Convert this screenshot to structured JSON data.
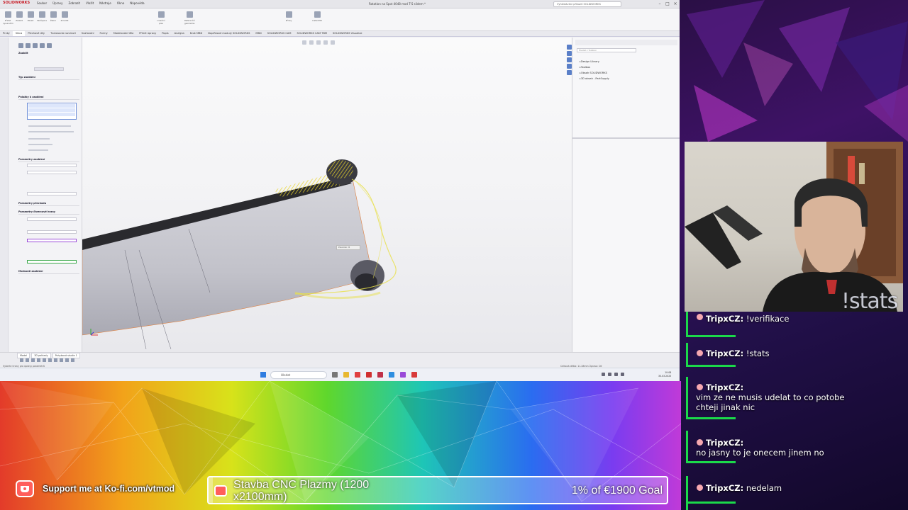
{
  "solidworks": {
    "app_name": "SOLIDWORKS",
    "doc_title": "Rotation na Spot 4048 mod T-S slidem *",
    "search_placeholder": "Vyhledávání příkazů SOLIDWORKS",
    "menu": [
      "Soubor",
      "Úpravy",
      "Zobrazit",
      "Vložit",
      "Nástroje",
      "Okno",
      "Nápověda"
    ],
    "tabs": [
      "Prvky",
      "Skica",
      "Plechové díly",
      "Tvarovaná rozvinutí",
      "Svařování",
      "Formy",
      "Modelování těla",
      "Přímé úpravy",
      "Popis",
      "Analýza",
      "Krok MBD",
      "Doplňkové moduly SOLIDWORKS",
      "MBD",
      "SOLIDWORKS CAM",
      "SOLIDWORKS CAM TBM",
      "SOLIDWORKS Visualize"
    ],
    "active_tab": "Prvky",
    "ribbon_buttons": [
      "Přidat vysunutím",
      "Zaoblit",
      "Zkosit",
      "Skořepina",
      "Žebro",
      "Zrcadlit",
      "Lineární pole",
      "Referenční geometrie",
      "Křivky",
      "Instant3D"
    ],
    "left_panel": {
      "title": "Zaoblit",
      "sections": [
        "Typ zaoblení",
        "Položky k zaoblení",
        "Parametry zaoblení",
        "Parametry přechodu",
        "Parametry čtvercové hrany",
        "Možnosti zaoblení"
      ]
    },
    "task_pane": {
      "search_placeholder": "Hledat v Toolbox",
      "tree": [
        "Design Library",
        "Toolbox",
        "Obsah SOLIDWORKS",
        "3D obsah - PartSupply"
      ]
    },
    "bottom_tabs": [
      "Model",
      "3D pohledy",
      "Pohybová studie 1"
    ],
    "status_left": "Vyberte hrany pro úpravy parametrů",
    "status_right": "Celková délka: 11.28mm    Úprava: Díl",
    "tooltip": "Poloměr: 8"
  },
  "taskbar": {
    "search_label": "Hledat",
    "time": "10:08",
    "date": "30.03.2025"
  },
  "overlay": {
    "stats_text": "!stats",
    "kofi_text": "Support me at Ko-fi.com/vtmod",
    "goal_title": "Stavba CNC Plazmy (1200 x2100mm)",
    "goal_progress_text": "1% of €1900 Goal",
    "goal_fraction": 0.01
  },
  "chat": [
    {
      "user": "TripxCZ:",
      "text": "!verifikace"
    },
    {
      "user": "TripxCZ:",
      "text": "!stats"
    },
    {
      "user": "TripxCZ:",
      "text": "vim ze ne musis udelat to co potobe\nchteji jinak nic"
    },
    {
      "user": "TripxCZ:",
      "text": "no jasny to je onecem jinem no"
    },
    {
      "user": "TripxCZ:",
      "text": "nedelam"
    }
  ],
  "colors": {
    "chat_accent": "#1bd94a",
    "kofi": "#ff5e5b",
    "fillet_preview": "#e8e04a"
  }
}
